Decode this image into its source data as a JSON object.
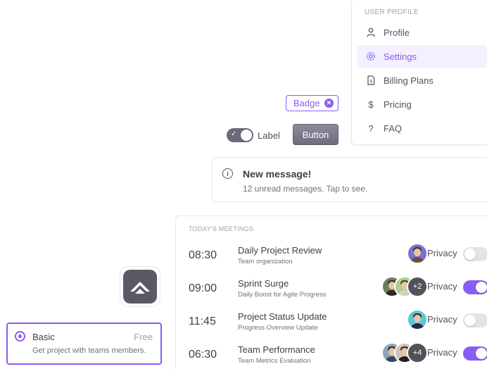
{
  "menu": {
    "header": "USER PROFILE",
    "items": [
      {
        "label": "Profile",
        "icon": "user-icon",
        "active": false
      },
      {
        "label": "Settings",
        "icon": "gear-icon",
        "active": true
      },
      {
        "label": "Billing Plans",
        "icon": "dollar-file-icon",
        "active": false
      },
      {
        "label": "Pricing",
        "icon": "dollar-icon",
        "active": false
      },
      {
        "label": "FAQ",
        "icon": "question-icon",
        "active": false
      }
    ]
  },
  "badge": {
    "label": "Badge"
  },
  "switch": {
    "label": "Label",
    "checked": true
  },
  "button": {
    "label": "Button"
  },
  "alert": {
    "title": "New message!",
    "description": "12 unread messages. Tap to see."
  },
  "meetings": {
    "header": "TODAY'S MEETINGS",
    "privacy_label": "Privacy",
    "rows": [
      {
        "time": "08:30",
        "title": "Daily Project Review",
        "subtitle": "Team organization",
        "extra": "",
        "privacy": false
      },
      {
        "time": "09:00",
        "title": "Sprint Surge",
        "subtitle": "Daily Boost for Agile Progress",
        "extra": "+2",
        "privacy": true
      },
      {
        "time": "11:45",
        "title": "Project Status Update",
        "subtitle": "Progress Overview Update",
        "extra": "",
        "privacy": false
      },
      {
        "time": "06:30",
        "title": "Team Performance",
        "subtitle": "Team Metrics Evaluation",
        "extra": "+4",
        "privacy": true
      }
    ]
  },
  "plan": {
    "name": "Basic",
    "price": "Free",
    "description": "Get project with teams members.",
    "selected": true
  },
  "colors": {
    "accent": "#8b5cf6",
    "dark": "#5b5966",
    "text": "#3f3f46"
  }
}
